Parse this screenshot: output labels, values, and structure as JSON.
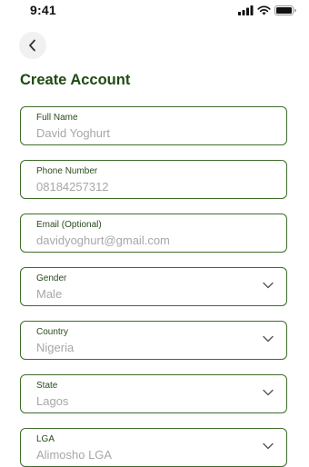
{
  "status_bar": {
    "time": "9:41",
    "icons": [
      "signal-icon",
      "wifi-icon",
      "battery-icon"
    ]
  },
  "header": {
    "back_icon": "chevron-left-icon",
    "title": "Create Account"
  },
  "form": {
    "fields": [
      {
        "label": "Full Name",
        "value": "David Yoghurt",
        "type": "text"
      },
      {
        "label": "Phone Number",
        "value": "08184257312",
        "type": "text"
      },
      {
        "label": "Email (Optional)",
        "value": "davidyoghurt@gmail.com",
        "type": "text"
      },
      {
        "label": "Gender",
        "value": "Male",
        "type": "select"
      },
      {
        "label": "Country",
        "value": "Nigeria",
        "type": "select"
      },
      {
        "label": "State",
        "value": "Lagos",
        "type": "select"
      },
      {
        "label": "LGA",
        "value": "Alimosho LGA",
        "type": "select"
      }
    ]
  },
  "colors": {
    "accent": "#1f4a12",
    "border": "#3e6d2b",
    "value_text": "#a7a7a7"
  }
}
